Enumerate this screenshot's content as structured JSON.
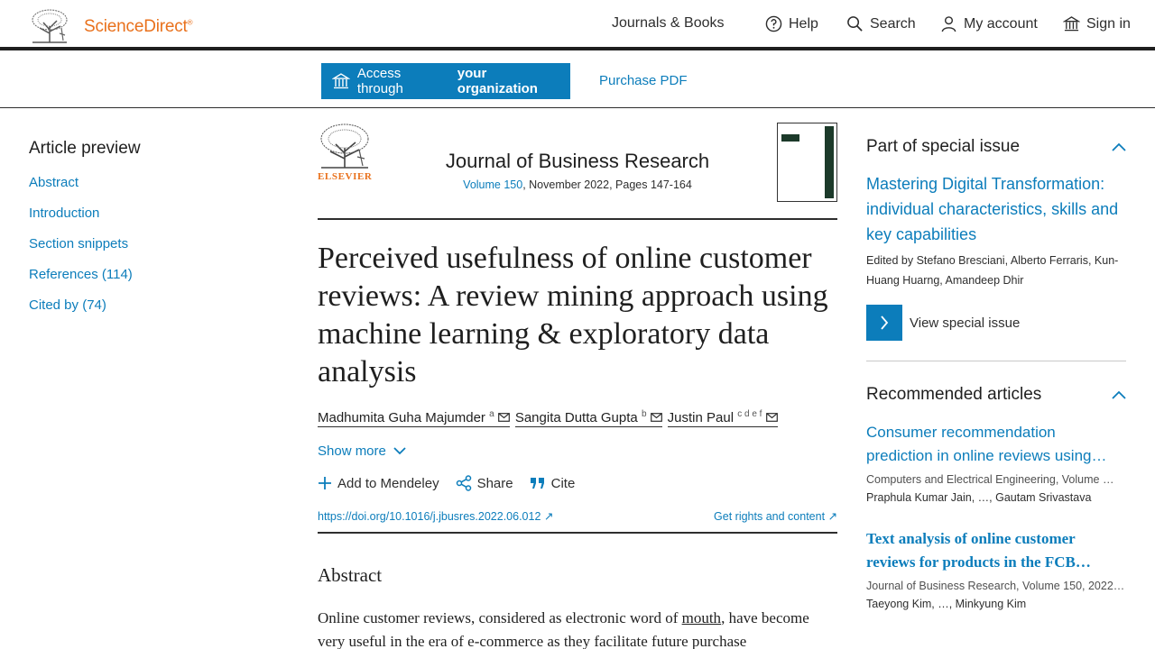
{
  "header": {
    "brand": "ScienceDirect",
    "brand_mark": "®",
    "nav": {
      "journals": "Journals & Books",
      "help": "Help",
      "search": "Search",
      "account": "My account",
      "signin": "Sign in"
    },
    "icons": [
      "elsevier-tree-logo",
      "help-circle-icon",
      "search-icon",
      "user-icon",
      "institution-icon"
    ]
  },
  "access": {
    "btn_prefix": "Access through",
    "btn_bold": "your organization",
    "purchase": "Purchase PDF"
  },
  "leftnav": {
    "heading": "Article preview",
    "items": [
      {
        "label": "Abstract"
      },
      {
        "label": "Introduction"
      },
      {
        "label": "Section snippets"
      },
      {
        "label": "References (114)"
      },
      {
        "label": "Cited by (74)"
      }
    ]
  },
  "article": {
    "publisher": "ELSEVIER",
    "journal": "Journal of Business Research",
    "volume": "Volume 150",
    "issue_info": ", November 2022, Pages 147-164",
    "title": "Perceived usefulness of online customer reviews: A review mining approach using machine learning & exploratory data analysis",
    "authors": [
      {
        "name": "Madhumita Guha Majumder",
        "sup": "a"
      },
      {
        "name": "Sangita Dutta Gupta",
        "sup": "b"
      },
      {
        "name": "Justin Paul",
        "sup": "c d e f"
      }
    ],
    "show_more": "Show more",
    "actions": {
      "mendeley": "Add to Mendeley",
      "share": "Share",
      "cite": "Cite"
    },
    "doi": "https://doi.org/10.1016/j.jbusres.2022.06.012 ↗",
    "rights": "Get rights and content ↗",
    "abstract_heading": "Abstract",
    "abstract_start": "Online customer reviews, considered as electronic word of ",
    "abstract_link": "mouth",
    "abstract_cont": ", have become very useful in the era of e-commerce as they facilitate future purchase"
  },
  "right": {
    "special_issue": {
      "heading": "Part of special issue",
      "title": "Mastering Digital Transformation: individual characteristics, skills and key capabilities",
      "editors": "Edited by Stefano Bresciani, Alberto Ferraris, Kun-Huang Huarng, Amandeep Dhir",
      "view": "View special issue"
    },
    "recommended": {
      "heading": "Recommended articles",
      "items": [
        {
          "title": "Consumer recommendation prediction in online reviews using…",
          "source": "Computers and Electrical Engineering, Volume …",
          "authors": "Praphula Kumar Jain, …, Gautam Srivastava"
        },
        {
          "title": "Text analysis of online customer reviews for products in the FCB…",
          "source": "Journal of Business Research, Volume 150, 2022…",
          "authors": "Taeyong Kim, …, Minkyung Kim"
        }
      ]
    }
  },
  "colors": {
    "brand_orange": "#e9711c",
    "link_blue": "#0c7dbb",
    "text_dark": "#1f1f1f"
  }
}
